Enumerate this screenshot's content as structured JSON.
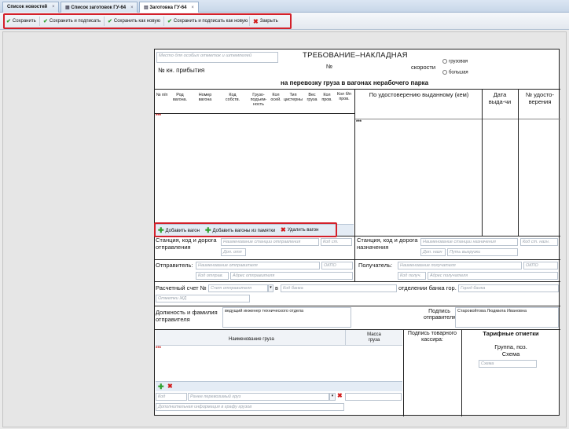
{
  "tabs": [
    {
      "label": "Список новостей"
    },
    {
      "label": "Список заготовок ГУ-64"
    },
    {
      "label": "Заготовка ГУ-64"
    }
  ],
  "toolbar": {
    "save": "Сохранить",
    "save_sign": "Сохранить и подписать",
    "save_new": "Сохранить как новую",
    "save_sign_new": "Сохранить и подписать как новую",
    "close": "Закрыть"
  },
  "form": {
    "stamp_placeholder": "Место для особых отметок и штемпелей",
    "title": "ТРЕБОВАНИЕ–НАКЛАДНАЯ",
    "no": "№",
    "arrival_no": "№ кн. прибытия",
    "speed": "скорости",
    "speed_cargo": "грузовая",
    "speed_high": "большая",
    "subtitle": "на перевозку груза в вагонах нерабочего парка",
    "cols": {
      "np": "№ п/п",
      "rod": "Род вагона.",
      "nomer": "Номер вагона",
      "kod": "Код собств.",
      "gruz": "Грузо-подъем-ность",
      "kol_osei": "Кол осей.",
      "tip": "Тип цистерны",
      "ves": "Вес груза",
      "kol_prov": "Кол пров.",
      "kol_b": "Кол б/п пров."
    },
    "cert_header": "По удостоверению выданному (кем)",
    "date_header": "Дата выда-чи",
    "num_header": "№ удосто-верения",
    "stars1": "***",
    "stars2": "***",
    "btn_add_wagon": "Добавить вагон",
    "btn_add_memo": "Добавить вагоны из памятки",
    "btn_del_wagon": "Удалить вагон",
    "from_station": "Станция, код и дорога отправления",
    "ph_station_from": "Наименование станции отправления",
    "ph_kod_st": "Код ст.",
    "ph_dop": "Доп. отп",
    "to_station": "Станция, код и дорога назначения",
    "ph_station_to": "Наименование станции назначения",
    "ph_kod_st_naz": "Код ст. назн.",
    "ph_dop_naz": "Доп. назн",
    "ph_put": "Путь выгрузки",
    "sender": "Отправитель:",
    "ph_sender": "Наименование отправителя",
    "ph_okpo": "ОКПО",
    "ph_kod_otpr": "Код отправ.",
    "ph_addr_otpr": "Адрес отправителя",
    "receiver": "Получатель:",
    "ph_receiver": "Наименование получателя",
    "ph_okpo2": "ОКПО",
    "ph_kod_pol": "Код получ.",
    "ph_addr_pol": "Адрес получателя",
    "account": "Расчетный счет №",
    "ph_account": "Счет отправителя",
    "in": "в",
    "ph_bank": "Код банка",
    "branch": "отделении банка гор.",
    "ph_city": "Город банка",
    "ph_otmetki": "Отметки ЖД",
    "position": "Должность и фамилия отправителя",
    "position_value": "ведущий инженер технического отдела",
    "signature": "Подпись отправителя",
    "signature_value": "Старовойтова Людмила Ивановна",
    "cargo_name": "Наименование груза",
    "cargo_mass": "Масса груза",
    "cashier": "Подпись товарного кассира:",
    "tariff": "Тарифные отметки",
    "group": "Группа, поз. Схема",
    "ph_scheme": "Схема",
    "ph_kod": "Код",
    "ph_prev_cargo": "Ранее перевозимый груз",
    "ph_extra": "Дополнительная информация в графу грузов"
  },
  "colors": {
    "accent": "#d3202a",
    "green": "#2e9e2e",
    "red": "#d21b1b"
  }
}
